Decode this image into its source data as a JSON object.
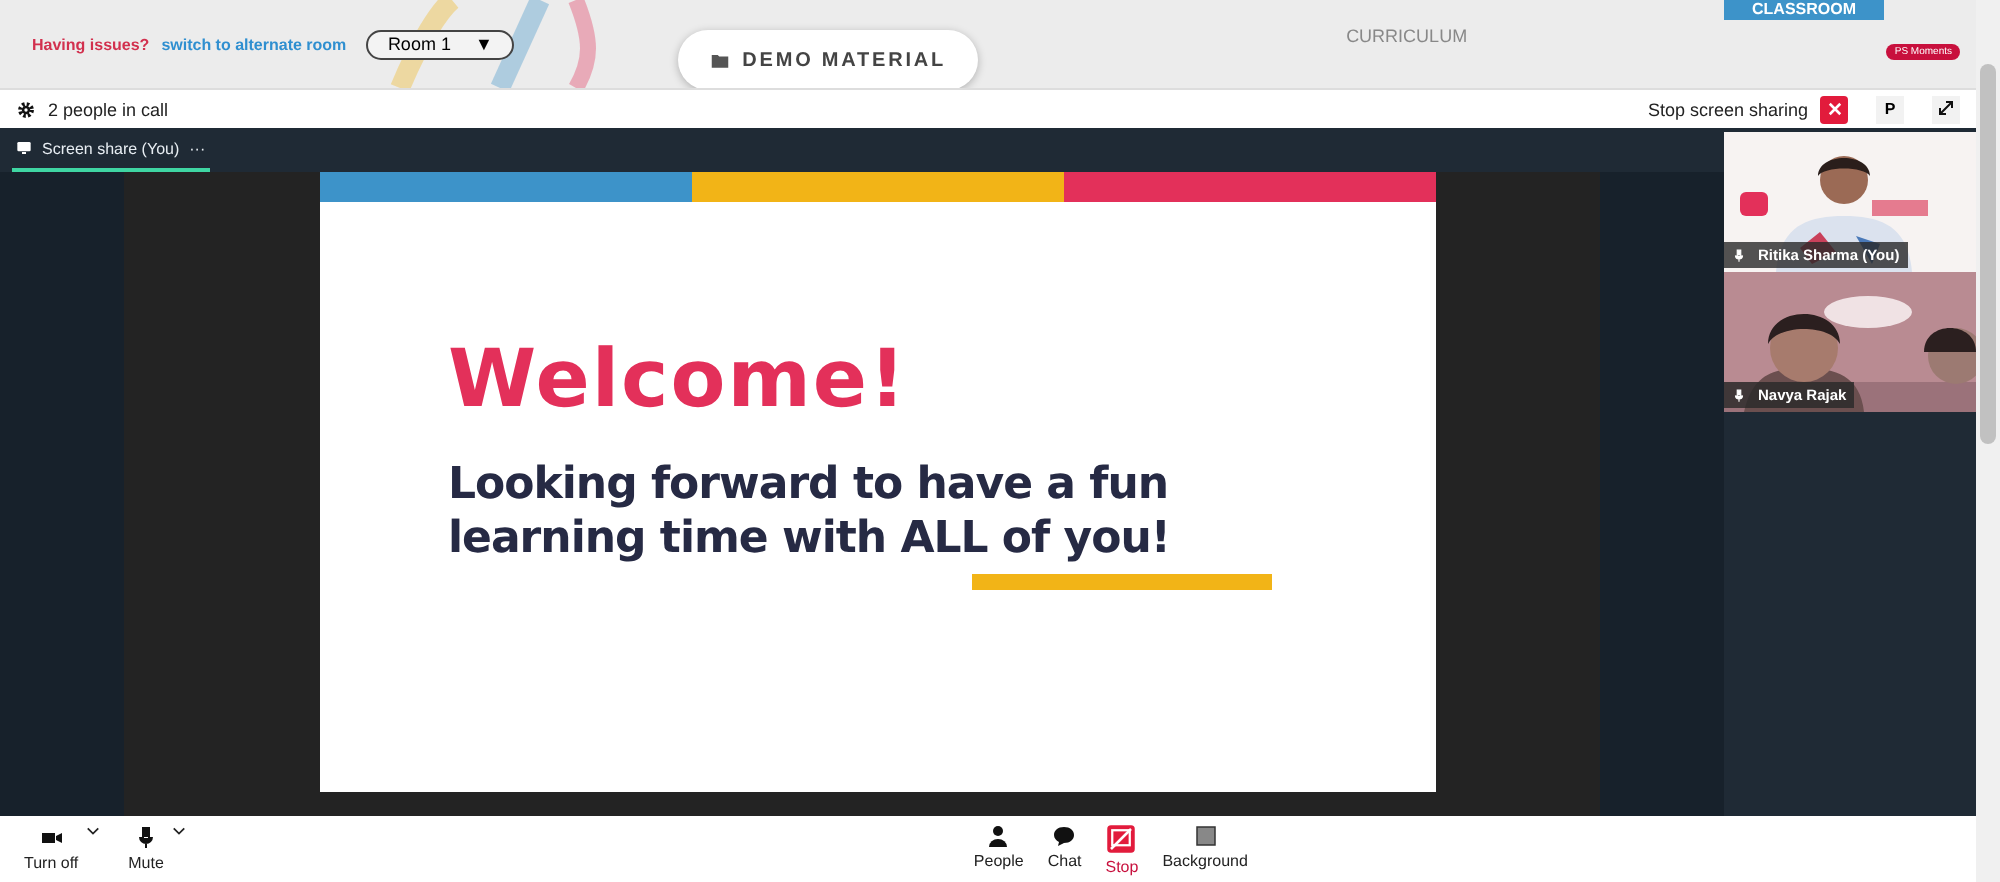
{
  "header": {
    "issue_text": "Having issues?",
    "alternate_link": "switch to alternate room",
    "room_select": "Room 1",
    "room_arrow": "▼",
    "center_tab": "DEMO MATERIAL",
    "curriculum_tab": "CURRICULUM",
    "classroom_tab": "CLASSROOM",
    "moments_badge": "PS Moments"
  },
  "call_bar": {
    "people_count": "2 people in call",
    "stop_sharing": "Stop screen sharing",
    "p_button": "P"
  },
  "stage_tab": {
    "label": "Screen share (You)",
    "more": "···",
    "selected": true
  },
  "slide": {
    "title": "Welcome!",
    "body": "Looking forward to have a fun learning time with ALL of you!"
  },
  "participants": [
    {
      "name": "Ritika Sharma (You)",
      "kind": "picture"
    },
    {
      "name": "Navya Rajak",
      "kind": "picture"
    }
  ],
  "left_controls": [
    {
      "label": "Turn off",
      "kind": "camera"
    },
    {
      "label": "Mute",
      "kind": "mic"
    }
  ],
  "center_controls": [
    {
      "label": "People",
      "kind": "person",
      "active": false
    },
    {
      "label": "Chat",
      "kind": "chat",
      "active": false
    },
    {
      "label": "Stop",
      "kind": "share",
      "active": true
    },
    {
      "label": "Background",
      "kind": "background",
      "active": false
    }
  ]
}
